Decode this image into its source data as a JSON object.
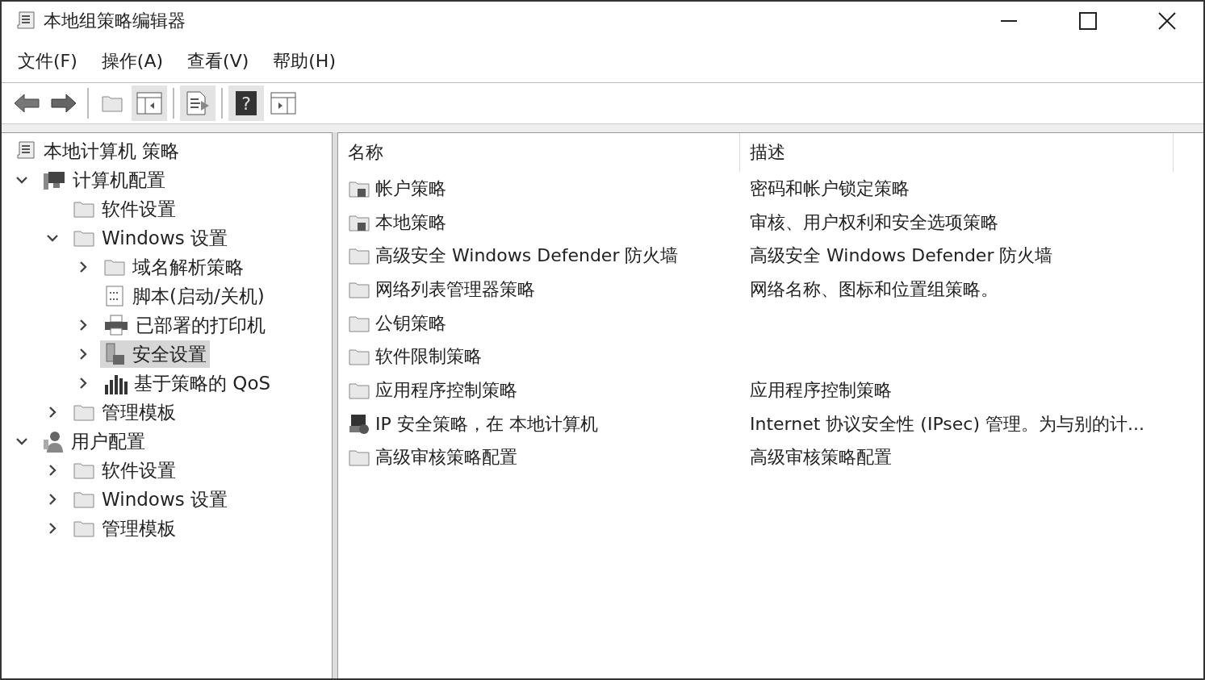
{
  "window": {
    "title": "本地组策略编辑器"
  },
  "menu": [
    "文件(F)",
    "操作(A)",
    "查看(V)",
    "帮助(H)"
  ],
  "toolbar": [
    {
      "kind": "back",
      "pressed": false
    },
    {
      "kind": "forward",
      "pressed": false
    },
    {
      "kind": "separator"
    },
    {
      "kind": "up",
      "pressed": false
    },
    {
      "kind": "tree-toggle",
      "pressed": true
    },
    {
      "kind": "separator"
    },
    {
      "kind": "export",
      "pressed": true
    },
    {
      "kind": "separator"
    },
    {
      "kind": "help",
      "pressed": true,
      "glyph": "?"
    },
    {
      "kind": "action-pane",
      "pressed": false
    }
  ],
  "tree": [
    {
      "label": "本地计算机 策略",
      "kind": "policy",
      "selected": false,
      "children": [
        {
          "label": "计算机配置",
          "kind": "computer",
          "selected": false,
          "expanded": true,
          "children": [
            {
              "label": "软件设置",
              "kind": "folder",
              "selected": false
            },
            {
              "label": "Windows 设置",
              "kind": "folder",
              "selected": false,
              "expanded": true,
              "children": [
                {
                  "label": "域名解析策略",
                  "kind": "folder",
                  "selected": false,
                  "expanded": false
                },
                {
                  "label": "脚本(启动/关机)",
                  "kind": "script",
                  "selected": false
                },
                {
                  "label": "已部署的打印机",
                  "kind": "printer",
                  "selected": false,
                  "expanded": false
                },
                {
                  "label": "安全设置",
                  "kind": "security",
                  "selected": true,
                  "expanded": false
                },
                {
                  "label": "基于策略的 QoS",
                  "kind": "chart",
                  "selected": false,
                  "expanded": false
                }
              ]
            },
            {
              "label": "管理模板",
              "kind": "folder",
              "selected": false,
              "expanded": false
            }
          ]
        },
        {
          "label": "用户配置",
          "kind": "user",
          "selected": false,
          "expanded": true,
          "children": [
            {
              "label": "软件设置",
              "kind": "folder",
              "selected": false,
              "expanded": false
            },
            {
              "label": "Windows 设置",
              "kind": "folder",
              "selected": false,
              "expanded": false
            },
            {
              "label": "管理模板",
              "kind": "folder",
              "selected": false,
              "expanded": false
            }
          ]
        }
      ]
    }
  ],
  "table": {
    "columns": [
      "名称",
      "描述"
    ],
    "rows": [
      {
        "kind": "locked-folder",
        "name": "帐户策略",
        "description": "密码和帐户锁定策略"
      },
      {
        "kind": "locked-folder",
        "name": "本地策略",
        "description": "审核、用户权利和安全选项策略"
      },
      {
        "kind": "folder",
        "name": "高级安全 Windows Defender 防火墙",
        "description": "高级安全 Windows Defender 防火墙"
      },
      {
        "kind": "folder",
        "name": "网络列表管理器策略",
        "description": "网络名称、图标和位置组策略。"
      },
      {
        "kind": "folder",
        "name": "公钥策略"
      },
      {
        "kind": "folder",
        "name": "软件限制策略"
      },
      {
        "kind": "folder",
        "name": "应用程序控制策略",
        "description": "应用程序控制策略"
      },
      {
        "kind": "ipsec",
        "name": "IP 安全策略，在 本地计算机",
        "description": "Internet 协议安全性 (IPsec) 管理。为与别的计..."
      },
      {
        "kind": "folder",
        "name": "高级审核策略配置",
        "description": "高级审核策略配置"
      }
    ]
  }
}
